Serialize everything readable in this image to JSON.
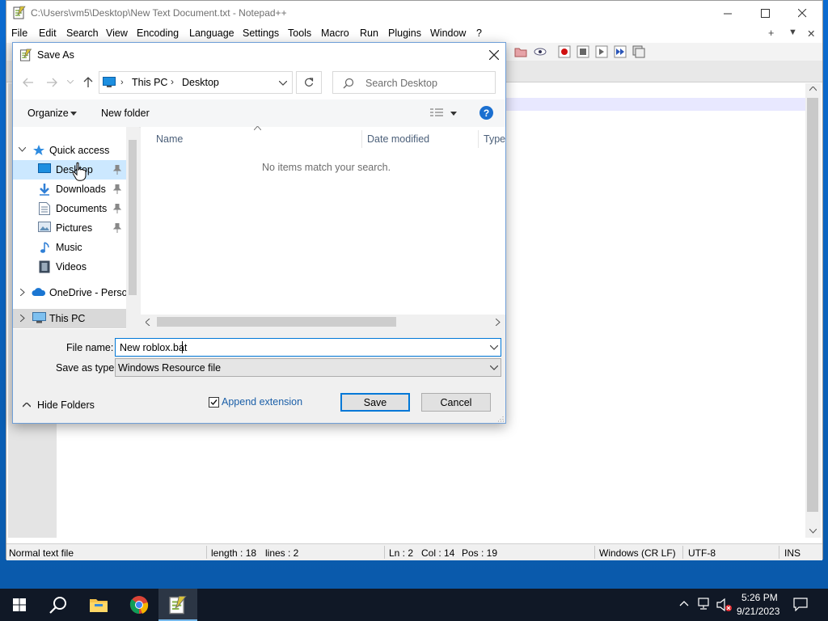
{
  "notepad": {
    "title": "C:\\Users\\vm5\\Desktop\\New Text Document.txt - Notepad++",
    "menu": [
      "File",
      "Edit",
      "Search",
      "View",
      "Encoding",
      "Language",
      "Settings",
      "Tools",
      "Macro",
      "Run",
      "Plugins",
      "Window",
      "?"
    ],
    "menu_right": [
      "+",
      "▼",
      "✕"
    ],
    "status": {
      "type": "Normal text file",
      "length": "length : 18",
      "lines": "lines : 2",
      "ln": "Ln : 2",
      "col": "Col : 14",
      "pos": "Pos : 19",
      "eol": "Windows (CR LF)",
      "encoding": "UTF-8",
      "mode": "INS"
    }
  },
  "dialog": {
    "title": "Save As",
    "breadcrumb": [
      "This PC",
      "Desktop"
    ],
    "search_placeholder": "Search Desktop",
    "organize": "Organize",
    "new_folder": "New folder",
    "columns": [
      "Name",
      "Date modified",
      "Type"
    ],
    "empty_message": "No items match your search.",
    "tree": {
      "quick_access": "Quick access",
      "items": [
        "Desktop",
        "Downloads",
        "Documents",
        "Pictures",
        "Music",
        "Videos"
      ],
      "onedrive": "OneDrive - Persor",
      "this_pc": "This PC"
    },
    "file_name_label": "File name:",
    "file_name_value": "New roblox.bat",
    "save_type_label": "Save as type:",
    "save_type_value": "Windows Resource file",
    "hide_folders": "Hide Folders",
    "append_extension": "Append extension",
    "append_checked": true,
    "save": "Save",
    "cancel": "Cancel"
  },
  "taskbar": {
    "time": "5:26 PM",
    "date": "9/21/2023"
  },
  "colors": {
    "accent": "#0078d7",
    "taskbar": "#101826",
    "desktop": "#0a5fb4"
  }
}
